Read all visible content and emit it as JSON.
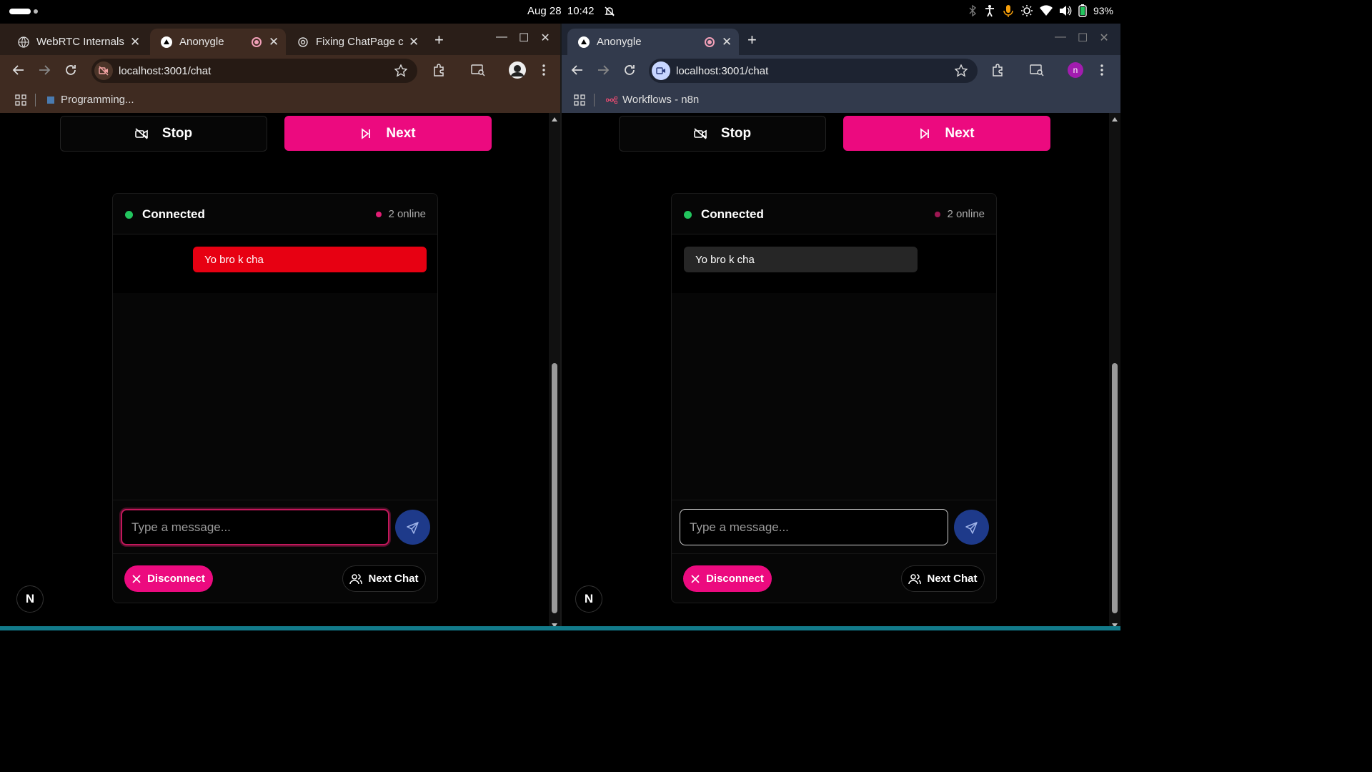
{
  "system_bar": {
    "date": "Aug 28",
    "time": "10:42",
    "battery": "93%"
  },
  "left_window": {
    "tabs": [
      {
        "title": "WebRTC Internals",
        "icon": "globe-icon"
      },
      {
        "title": "Anonygle",
        "icon": "triangle-icon",
        "recording": true
      },
      {
        "title": "Fixing ChatPage c",
        "icon": "openai-icon"
      }
    ],
    "url": "localhost:3001/chat",
    "bookmark": "Programming...",
    "page": {
      "stop_label": "Stop",
      "next_label": "Next",
      "status": "Connected",
      "online": "2 online",
      "messages": [
        "Yo bro k cha"
      ],
      "input_placeholder": "Type a message...",
      "disconnect_label": "Disconnect",
      "next_chat_label": "Next Chat",
      "badge": "N"
    }
  },
  "right_window": {
    "tabs": [
      {
        "title": "Anonygle",
        "icon": "triangle-icon",
        "recording": true
      }
    ],
    "url": "localhost:3001/chat",
    "profile_initial": "n",
    "bookmark": "Workflows - n8n",
    "page": {
      "stop_label": "Stop",
      "next_label": "Next",
      "status": "Connected",
      "online": "2 online",
      "messages": [
        "Yo bro k cha"
      ],
      "input_placeholder": "Type a message...",
      "disconnect_label": "Disconnect",
      "next_chat_label": "Next Chat",
      "badge": "N"
    }
  },
  "colors": {
    "accent_pink": "#ec0a7f",
    "own_bubble": "#e70012",
    "other_bubble": "#262626",
    "connected_green": "#22c55e",
    "send_blue": "#1e3a8a"
  }
}
